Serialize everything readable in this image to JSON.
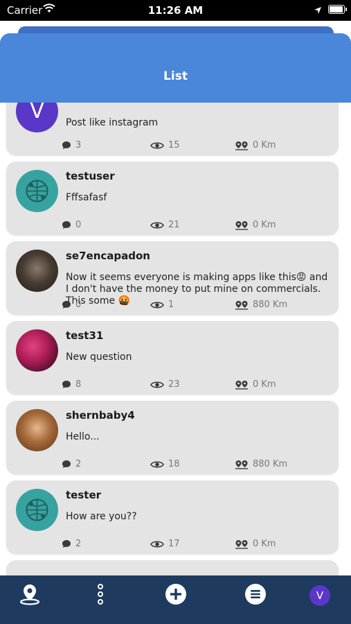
{
  "status_bar": {
    "carrier": "Carrier",
    "time": "11:26 AM"
  },
  "header": {
    "title": "List"
  },
  "posts": [
    {
      "username": "",
      "avatar_letter": "V",
      "text": "Post like instagram",
      "comments": "3",
      "views": "15",
      "distance": "0 Km"
    },
    {
      "username": "testuser",
      "text": "Fffsafasf",
      "comments": "0",
      "views": "21",
      "distance": "0 Km"
    },
    {
      "username": "se7encapadon",
      "text": "Now it seems everyone is making apps like this😡 and I don't have the money to put mine on commercials. This some 🤬",
      "comments": "0",
      "views": "1",
      "distance": "880 Km"
    },
    {
      "username": "test31",
      "text": "New question",
      "comments": "8",
      "views": "23",
      "distance": "0 Km"
    },
    {
      "username": "shernbaby4",
      "text": "Hello...",
      "comments": "2",
      "views": "18",
      "distance": "880 Km"
    },
    {
      "username": "tester",
      "text": "How are you??",
      "comments": "2",
      "views": "17",
      "distance": "0 Km"
    }
  ],
  "tabbar": {
    "profile_letter": "V"
  },
  "colors": {
    "header": "#4a86d9",
    "tabbar": "#1e3a5f",
    "card": "#e4e4e4",
    "avatar_purple": "#5a36c9"
  }
}
